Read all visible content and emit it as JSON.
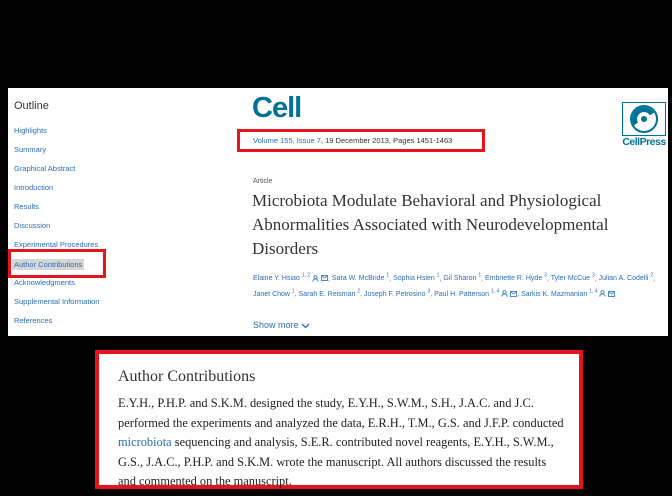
{
  "sidebar": {
    "title": "Outline",
    "items": [
      {
        "label": "Highlights"
      },
      {
        "label": "Summary"
      },
      {
        "label": "Graphical Abstract"
      },
      {
        "label": "Introduction"
      },
      {
        "label": "Results"
      },
      {
        "label": "Discussion"
      },
      {
        "label": "Experimental Procedures"
      },
      {
        "label": "Author Contributions"
      },
      {
        "label": "Acknowledgments"
      },
      {
        "label": "Supplemental Information"
      },
      {
        "label": "References"
      }
    ],
    "active_item": "Author Contributions"
  },
  "journal": {
    "logo_text": "Cell",
    "publisher_logo_text": "CellPress",
    "citation_link": "Volume 155, Issue 7",
    "citation_rest": ", 19 December 2013, Pages 1451-1463"
  },
  "article": {
    "type": "Article",
    "title": "Microbiota Modulate Behavioral and Physiological Abnormalities Associated with Neurodevelopmental Disorders",
    "authors_html_line1": "Elaine Y. Hsiao ",
    "show_more": "Show more"
  },
  "authors": [
    {
      "name": "Elaine Y. Hsiao",
      "sup": "1, 2"
    },
    {
      "name": "Sara W. McBride",
      "sup": "1"
    },
    {
      "name": "Sophia Hsien",
      "sup": "1"
    },
    {
      "name": "Gil Sharon",
      "sup": "1"
    },
    {
      "name": "Embriette R. Hyde",
      "sup": "3"
    },
    {
      "name": "Tyler McCue",
      "sup": "3"
    },
    {
      "name": "Julian A. Codelli",
      "sup": "2"
    },
    {
      "name": "Janet Chow",
      "sup": "1"
    },
    {
      "name": "Sarah E. Reisman",
      "sup": "2"
    },
    {
      "name": "Joseph F. Petrosino",
      "sup": "3"
    },
    {
      "name": "Paul H. Patterson",
      "sup": "1, 4"
    },
    {
      "name": "Sarkis K. Mazmanian",
      "sup": "1, 4"
    }
  ],
  "author_contributions": {
    "heading": "Author Contributions",
    "text_before_link": "E.Y.H., P.H.P. and S.K.M. designed the study, E.Y.H., S.W.M., S.H., J.A.C. and J.C. performed the experiments and analyzed the data, E.R.H., T.M., G.S. and J.F.P. conducted ",
    "link_text": "microbiota",
    "text_after_link": " sequencing and analysis, S.E.R. contributed novel reagents, E.Y.H., S.W.M., G.S., J.A.C., P.H.P. and S.K.M. wrote the manuscript. All authors discussed the results and commented on the manuscript."
  },
  "colors": {
    "highlight_box": "#e8131b",
    "link": "#2a6ebb",
    "cell_brand": "#00729a"
  }
}
